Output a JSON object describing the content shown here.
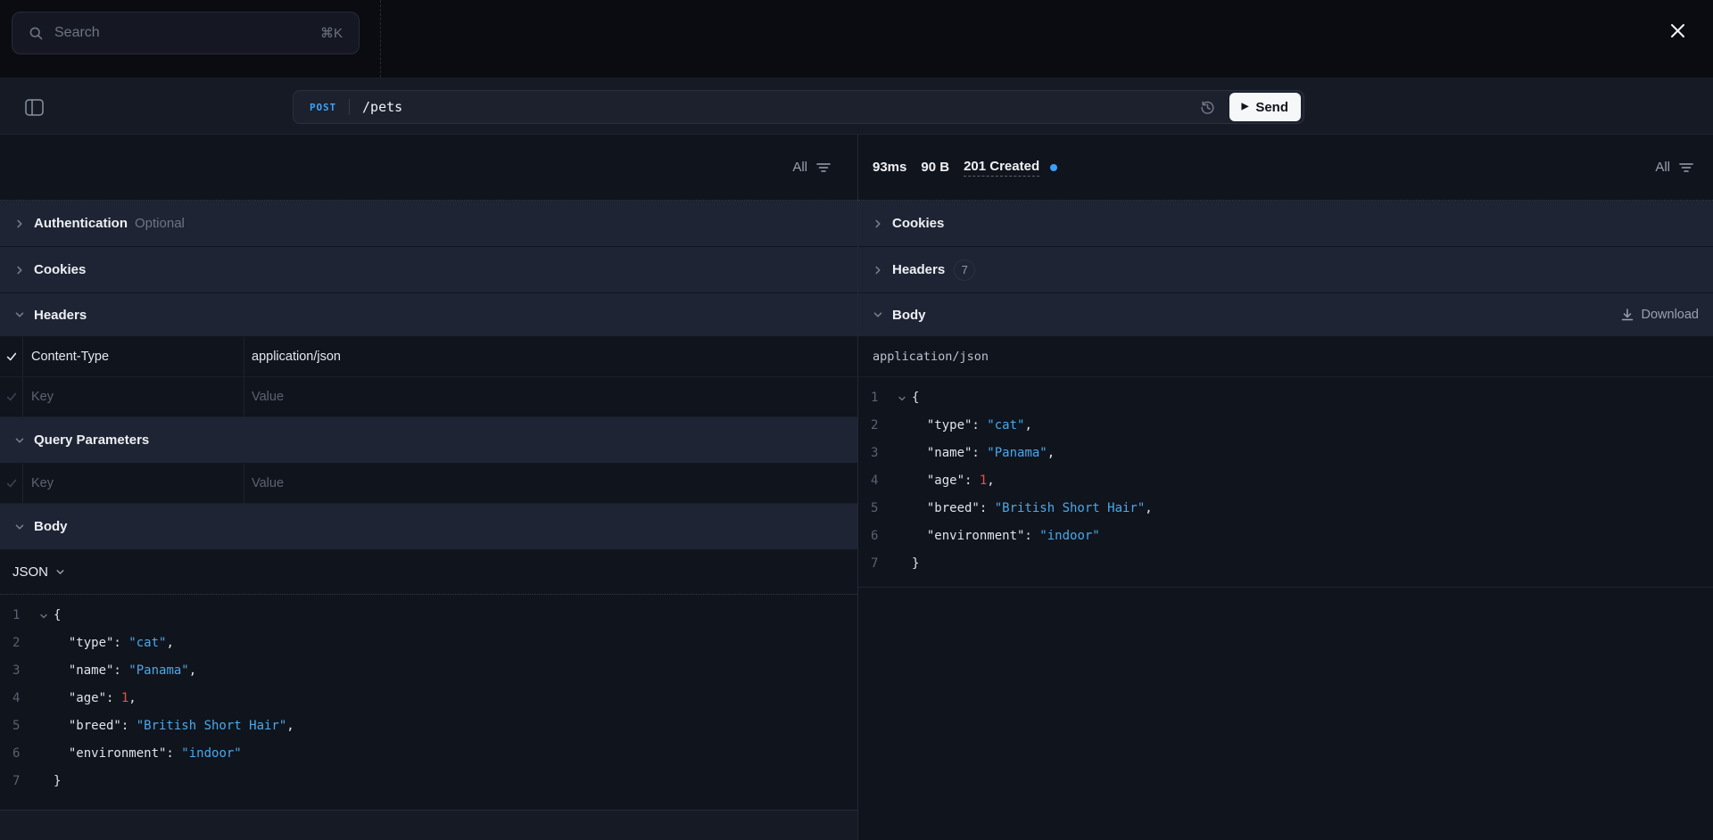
{
  "topbar": {
    "search": {
      "placeholder": "Search",
      "shortcut": "⌘K"
    }
  },
  "toolbar": {
    "method": "POST",
    "url": "/pets",
    "send_label": "Send",
    "play_glyph": "▶"
  },
  "request_panel": {
    "filter_label": "All",
    "sections": {
      "authentication": {
        "label": "Authentication",
        "hint": "Optional"
      },
      "cookies": {
        "label": "Cookies"
      },
      "headers": {
        "label": "Headers",
        "rows": [
          {
            "key": "Content-Type",
            "value": "application/json",
            "checked": true
          },
          {
            "key_placeholder": "Key",
            "value_placeholder": "Value",
            "checked": false
          }
        ]
      },
      "query_parameters": {
        "label": "Query Parameters",
        "key_placeholder": "Key",
        "value_placeholder": "Value"
      },
      "body": {
        "label": "Body",
        "format_selector": "JSON"
      }
    }
  },
  "response_panel": {
    "filter_label": "All",
    "stats": {
      "duration": "93ms",
      "size": "90 B",
      "status": "201 Created"
    },
    "sections": {
      "cookies": {
        "label": "Cookies"
      },
      "headers": {
        "label": "Headers",
        "count": "7"
      },
      "body": {
        "label": "Body",
        "download_label": "Download",
        "content_type": "application/json"
      }
    }
  },
  "json_body": {
    "lines": [
      {
        "num": "1",
        "fold": true,
        "tokens": [
          [
            "{",
            "w"
          ]
        ]
      },
      {
        "num": "2",
        "tokens": [
          [
            "  \"type\": ",
            "w"
          ],
          [
            "\"cat\"",
            "s"
          ],
          [
            ",",
            "w"
          ]
        ]
      },
      {
        "num": "3",
        "tokens": [
          [
            "  \"name\": ",
            "w"
          ],
          [
            "\"Panama\"",
            "s"
          ],
          [
            ",",
            "w"
          ]
        ]
      },
      {
        "num": "4",
        "tokens": [
          [
            "  \"age\": ",
            "w"
          ],
          [
            "1",
            "n"
          ],
          [
            ",",
            "w"
          ]
        ]
      },
      {
        "num": "5",
        "tokens": [
          [
            "  \"breed\": ",
            "w"
          ],
          [
            "\"British Short Hair\"",
            "s"
          ],
          [
            ",",
            "w"
          ]
        ]
      },
      {
        "num": "6",
        "tokens": [
          [
            "  \"environment\": ",
            "w"
          ],
          [
            "\"indoor\"",
            "s"
          ]
        ]
      },
      {
        "num": "7",
        "tokens": [
          [
            "}",
            "w"
          ]
        ]
      }
    ]
  },
  "colors": {
    "accent_blue": "#3ea1f4",
    "string_blue": "#4aa9e9",
    "number_red": "#e5534b",
    "status_dot_blue": "#3b9eff",
    "send_button_bg": "#f6f7f9"
  }
}
